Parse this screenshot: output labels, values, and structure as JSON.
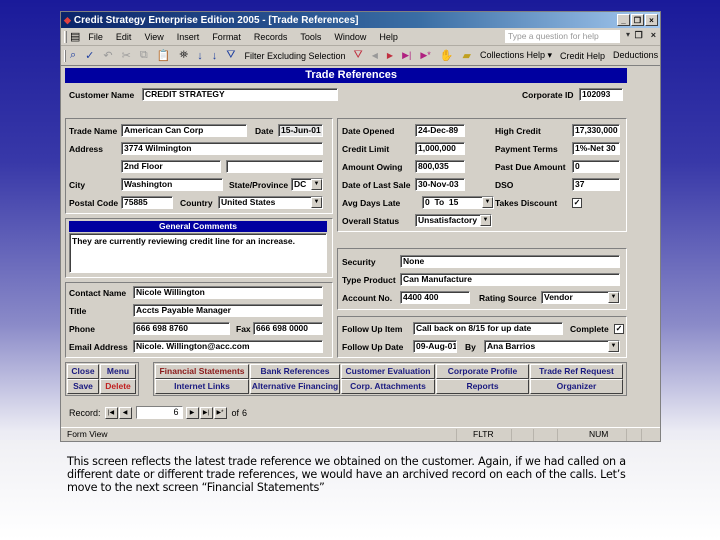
{
  "window": {
    "title": "Credit Strategy Enterprise Edition 2005 - [Trade References]",
    "controls": [
      "_",
      "❐",
      "×"
    ]
  },
  "menubar": {
    "items": [
      "File",
      "Edit",
      "View",
      "Insert",
      "Format",
      "Records",
      "Tools",
      "Window",
      "Help"
    ],
    "help_placeholder": "Type a question for help"
  },
  "toolbar": {
    "filter_label": "Filter Excluding Selection",
    "collections_help": "Collections Help ▾",
    "credit_help": "Credit Help",
    "deductions_help": "Deductions Help ▾",
    "overflow": "»"
  },
  "form": {
    "header": "Trade References",
    "customer_name_label": "Customer Name",
    "customer_name": "CREDIT STRATEGY",
    "corporate_id_label": "Corporate ID",
    "corporate_id": "102093",
    "trade": {
      "trade_name_label": "Trade Name",
      "trade_name": "American Can Corp",
      "date_label": "Date",
      "date": "15-Jun-01",
      "address_label": "Address",
      "address1": "3774 Wilmington",
      "address2": "2nd Floor",
      "address3": "",
      "city_label": "City",
      "city": "Washington",
      "state_label": "State/Province",
      "state": "DC",
      "postal_label": "Postal Code",
      "postal": "75885",
      "country_label": "Country",
      "country": "United States"
    },
    "credit": {
      "date_opened_label": "Date Opened",
      "date_opened": "24-Dec-89",
      "credit_limit_label": "Credit Limit",
      "credit_limit": "1,000,000",
      "amount_owing_label": "Amount Owing",
      "amount_owing": "800,035",
      "last_sale_label": "Date of Last Sale",
      "last_sale": "30-Nov-03",
      "avg_days_late_label": "Avg Days Late",
      "avg_days_late": "0  To  15",
      "overall_status_label": "Overall Status",
      "overall_status": "Unsatisfactory",
      "high_credit_label": "High Credit",
      "high_credit": "17,330,000",
      "payment_terms_label": "Payment Terms",
      "payment_terms": "1%-Net 30",
      "past_due_label": "Past Due Amount",
      "past_due": "0",
      "dso_label": "DSO",
      "dso": "37",
      "takes_discount_label": "Takes Discount",
      "takes_discount": true
    },
    "comments": {
      "header": "General Comments",
      "text": "They are currently reviewing credit line for an increase."
    },
    "security": {
      "security_label": "Security",
      "security": "None",
      "type_product_label": "Type Product",
      "type_product": "Can Manufacture",
      "account_no_label": "Account No.",
      "account_no": "4400 400",
      "rating_source_label": "Rating Source",
      "rating_source": "Vendor"
    },
    "contact": {
      "contact_name_label": "Contact Name",
      "contact_name": "Nicole Willington",
      "title_label": "Title",
      "title": "Accts Payable Manager",
      "phone_label": "Phone",
      "phone": "666 698 8760",
      "fax_label": "Fax",
      "fax": "666 698 0000",
      "email_label": "Email Address",
      "email": "Nicole. Willington@acc.com"
    },
    "followup": {
      "item_label": "Follow Up Item",
      "item": "Call back on 8/15 for up date",
      "complete_label": "Complete",
      "complete": true,
      "date_label": "Follow Up Date",
      "date": "09-Aug-01",
      "by_label": "By",
      "by": "Ana Barrios"
    },
    "buttons": {
      "close": "Close",
      "menu": "Menu",
      "save": "Save",
      "delete": "Delete",
      "financial_statements": "Financial Statements",
      "bank_references": "Bank References",
      "customer_evaluation": "Customer Evaluation",
      "corporate_profile": "Corporate Profile",
      "trade_ref_request": "Trade Ref Request",
      "internet_links": "Internet Links",
      "alternative_financing": "Alternative Financing",
      "corp_attachments": "Corp. Attachments",
      "reports": "Reports",
      "organizer": "Organizer"
    }
  },
  "record_nav": {
    "label": "Record:",
    "current": "6",
    "of_label": "of",
    "total": "6"
  },
  "statusbar": {
    "view": "Form View",
    "fltr": "FLTR",
    "num": "NUM"
  },
  "caption": "This screen reflects the latest trade reference we obtained on the customer. Again, if we had called on a different date or different trade references, we would have an archived record on each of the calls. Let’s move to the next screen “Financial Statements”"
}
